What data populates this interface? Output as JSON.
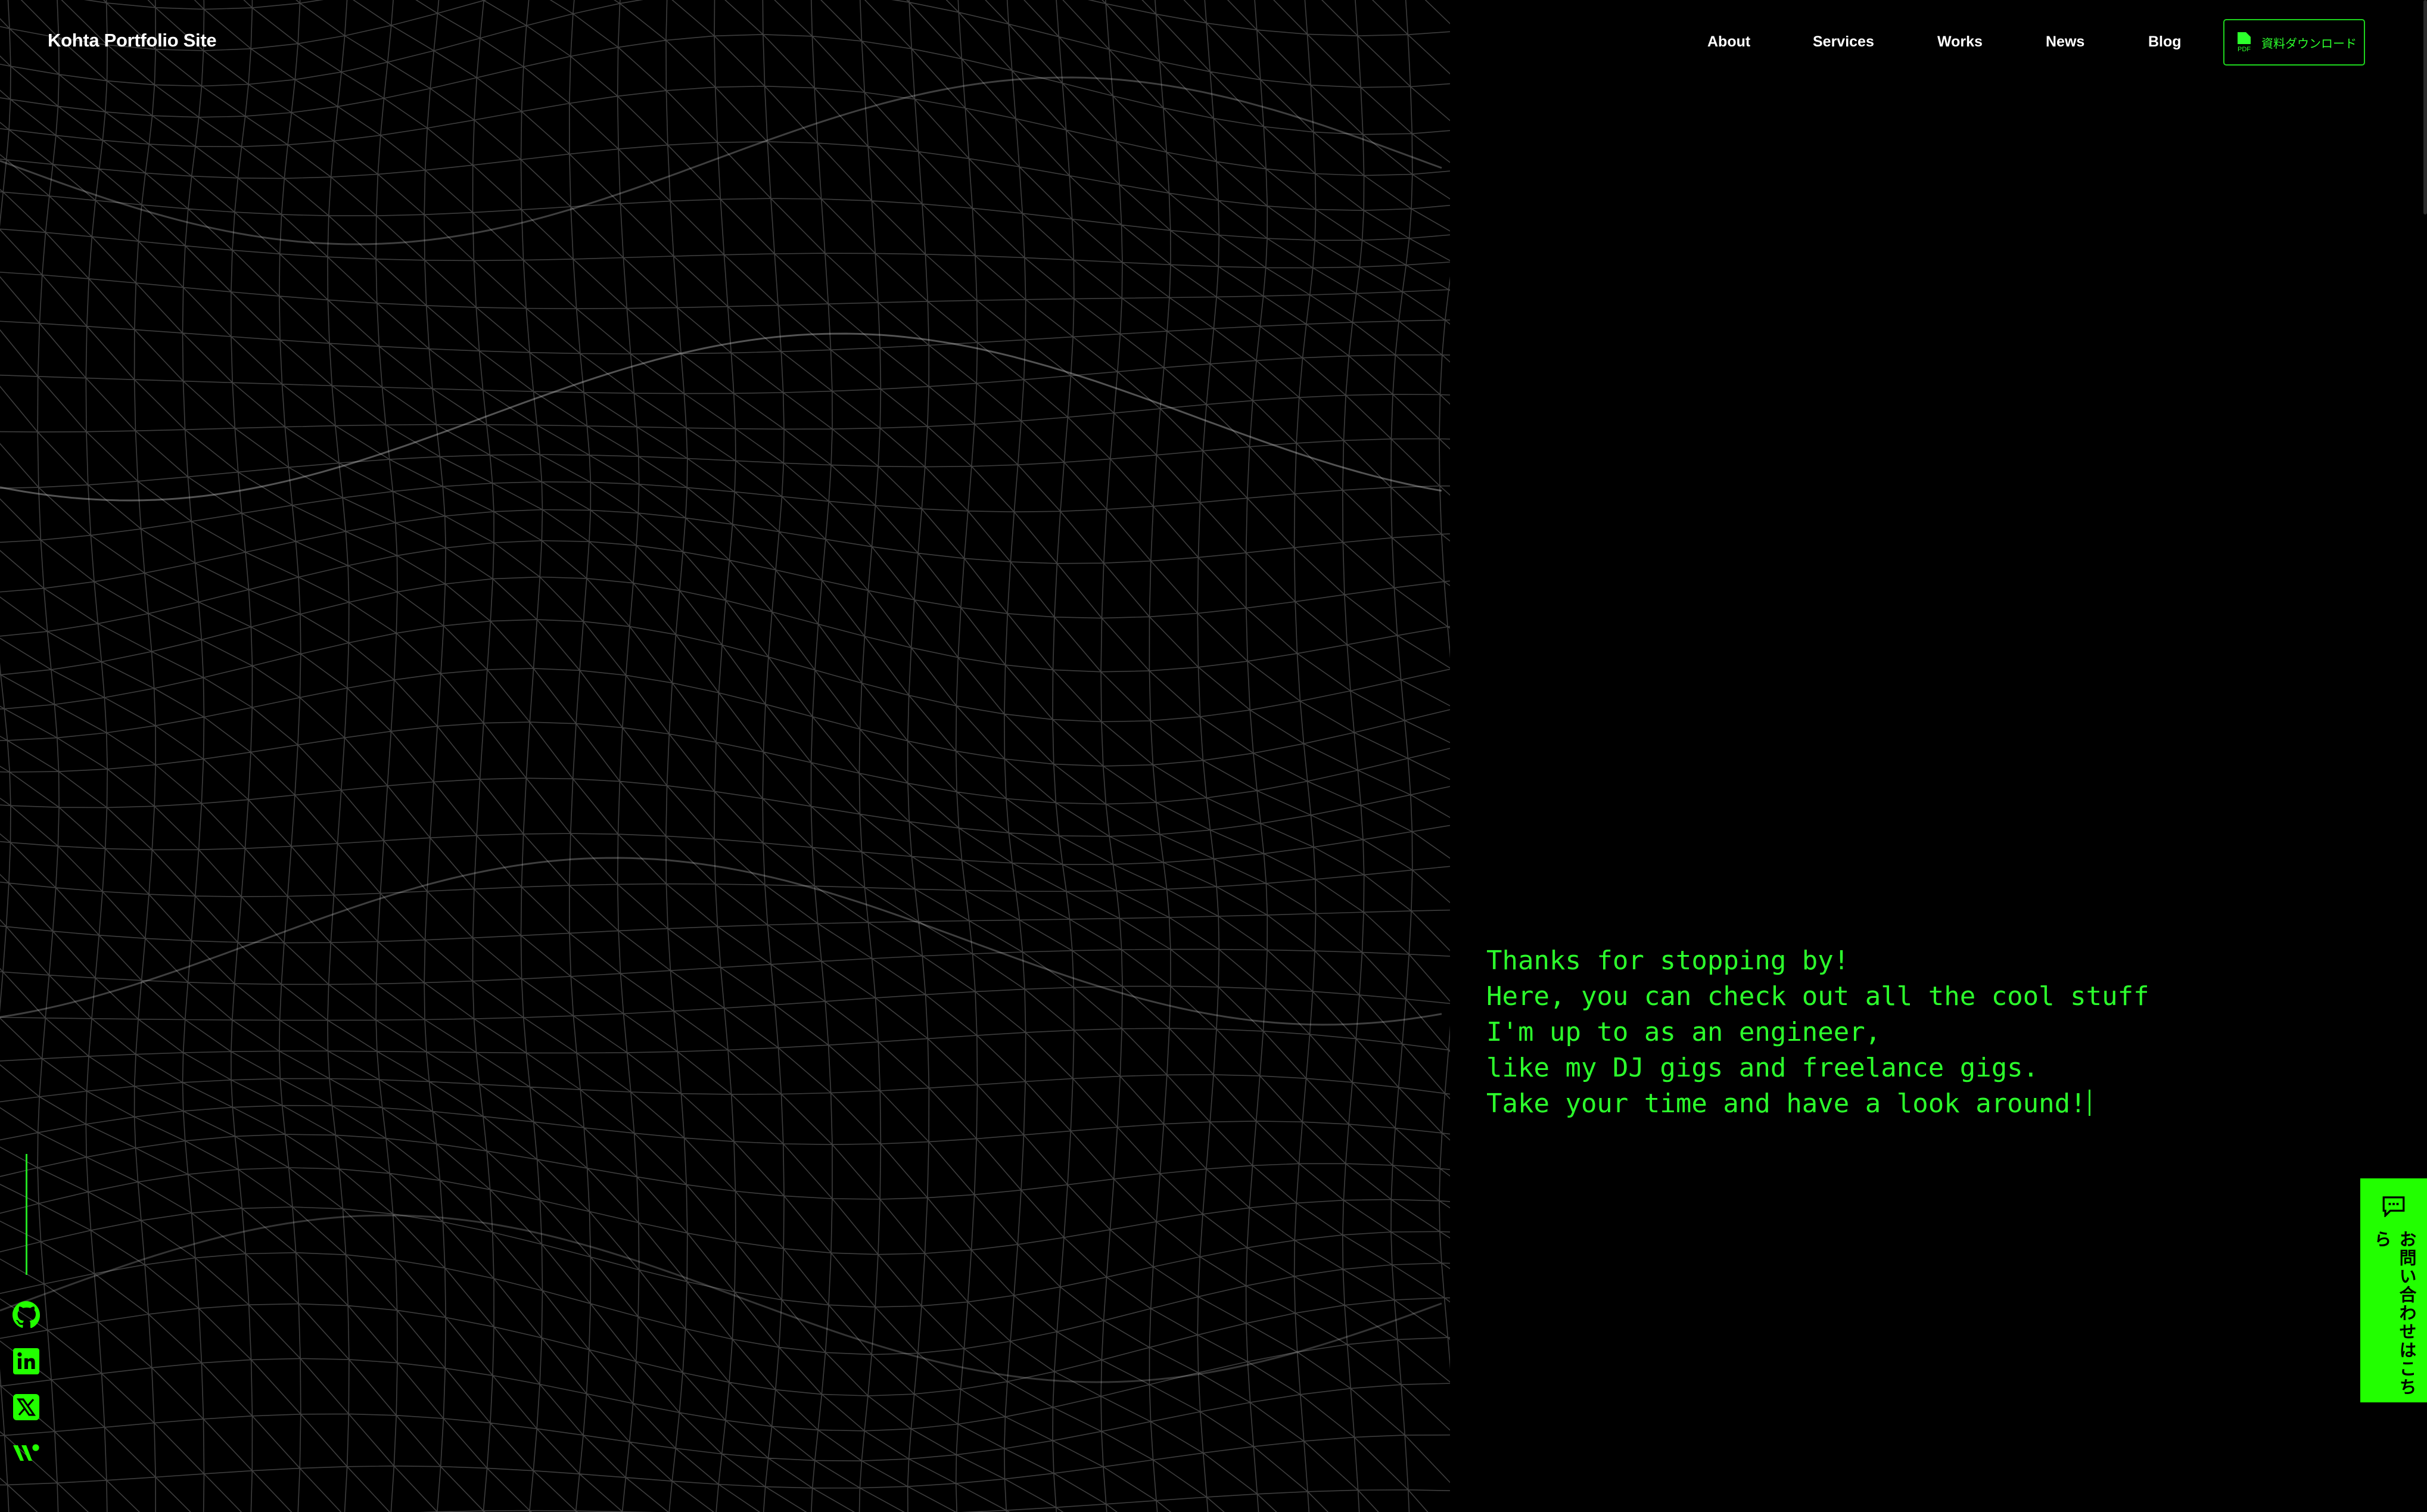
{
  "header": {
    "logo": "Kohta Portfolio Site",
    "nav": [
      {
        "label": "About"
      },
      {
        "label": "Services"
      },
      {
        "label": "Works"
      },
      {
        "label": "News"
      },
      {
        "label": "Blog"
      }
    ],
    "download_button": {
      "label": "資料ダウンロード",
      "icon": "pdf-file-icon",
      "icon_text": "PDF"
    }
  },
  "hero": {
    "lines": [
      "Thanks for stopping by!",
      "Here, you can check out all the cool stuff",
      "I'm up to as an engineer,",
      "like my DJ gigs and freelance gigs.",
      "Take your time and have a look around!"
    ]
  },
  "contact_tab": {
    "label": "お問い合わせはこちら",
    "icon": "chat-bubble-icon"
  },
  "social": [
    {
      "name": "github-icon"
    },
    {
      "name": "linkedin-icon"
    },
    {
      "name": "x-icon"
    },
    {
      "name": "wantedly-icon"
    }
  ],
  "colors": {
    "accent": "#22ff00",
    "background": "#000000",
    "text": "#ffffff"
  }
}
